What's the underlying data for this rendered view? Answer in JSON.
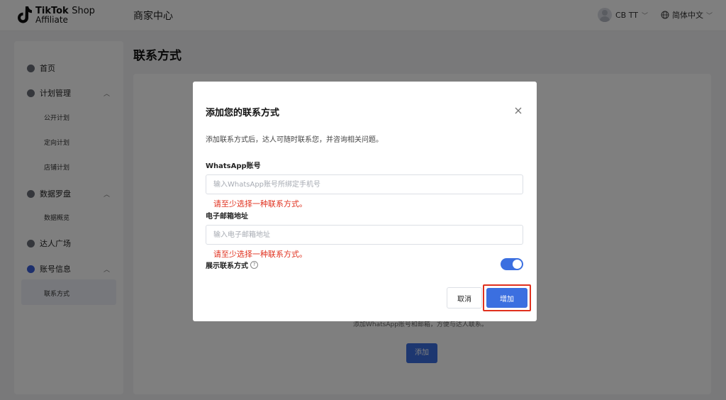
{
  "header": {
    "logo_brand": "TikTok",
    "logo_shop": "Shop",
    "logo_sub": "Affiliate",
    "title": "商家中心",
    "user_name": "CB TT",
    "language": "简体中文"
  },
  "sidebar": {
    "items": [
      {
        "label": "首页",
        "icon": "home-icon"
      },
      {
        "label": "计划管理",
        "icon": "plan-icon"
      },
      {
        "label": "公开计划"
      },
      {
        "label": "定向计划"
      },
      {
        "label": "店铺计划"
      },
      {
        "label": "数据罗盘",
        "icon": "compass-icon"
      },
      {
        "label": "数据概览"
      },
      {
        "label": "达人广场",
        "icon": "creator-icon"
      },
      {
        "label": "账号信息",
        "icon": "account-icon"
      },
      {
        "label": "联系方式"
      }
    ]
  },
  "main": {
    "title": "联系方式",
    "empty_hint": "添加WhatsApp账号和邮箱，方便与达人联系。",
    "add_button": "添加"
  },
  "modal": {
    "title": "添加您的联系方式",
    "description": "添加联系方式后，达人可随时联系您，并咨询相关问题。",
    "whatsapp_label": "WhatsApp账号",
    "whatsapp_placeholder": "输入WhatsApp账号所绑定手机号",
    "whatsapp_value": "",
    "whatsapp_error": "请至少选择一种联系方式。",
    "email_label": "电子邮箱地址",
    "email_placeholder": "输入电子邮箱地址",
    "email_value": "",
    "email_error": "请至少选择一种联系方式。",
    "show_contact_label": "展示联系方式",
    "show_contact_on": true,
    "cancel_label": "取消",
    "confirm_label": "增加"
  },
  "colors": {
    "primary": "#3b6fe0",
    "error": "#e0301e",
    "highlight": "#e0301e"
  }
}
